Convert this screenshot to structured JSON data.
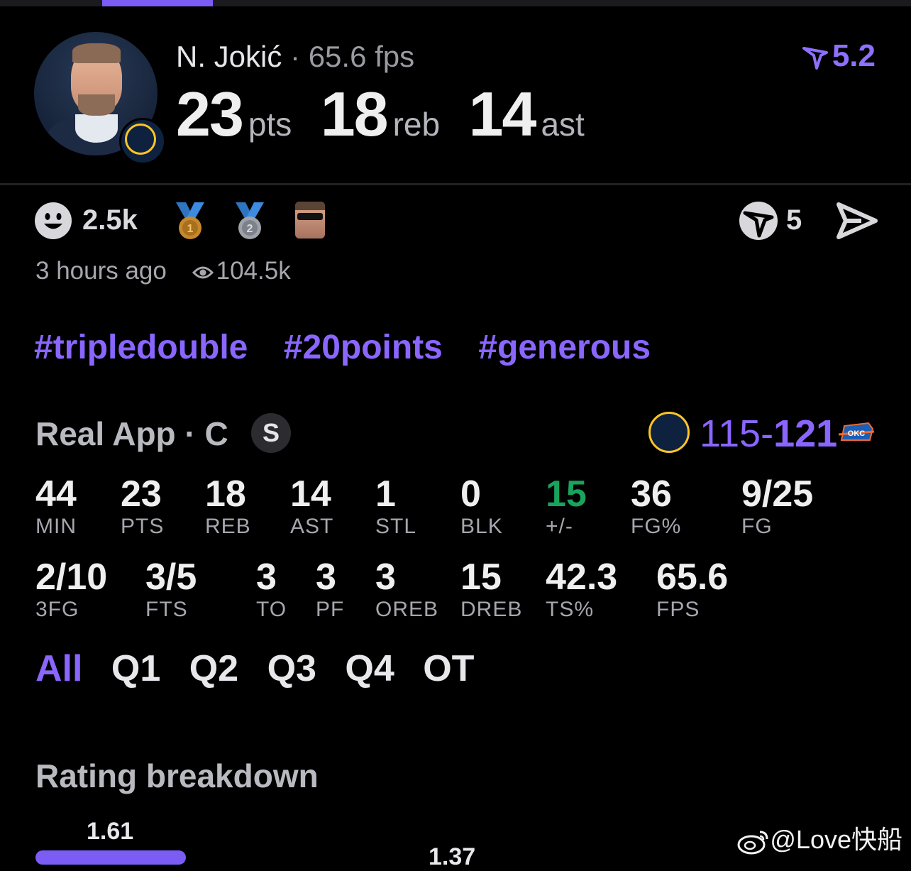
{
  "player": {
    "name": "N. Jokić",
    "separator": "·",
    "fps": "65.6 fps",
    "pts": "23",
    "pts_label": "pts",
    "reb": "18",
    "reb_label": "reb",
    "ast": "14",
    "ast_label": "ast",
    "rating": "5.2"
  },
  "social": {
    "reactions": "2.5k",
    "medal1": "1",
    "medal2": "2",
    "votes": "5",
    "time_ago": "3 hours ago",
    "views": "104.5k"
  },
  "tags": [
    "#tripledouble",
    "#20points",
    "#generous"
  ],
  "game": {
    "title": "Real App · C",
    "badge": "S",
    "score_home": "115",
    "score_dash": "-",
    "score_away": "121",
    "away_logo_text": "OKC"
  },
  "stats_row1": [
    {
      "v": "44",
      "l": "MIN"
    },
    {
      "v": "23",
      "l": "PTS"
    },
    {
      "v": "18",
      "l": "REB"
    },
    {
      "v": "14",
      "l": "AST"
    },
    {
      "v": "1",
      "l": "STL"
    },
    {
      "v": "0",
      "l": "BLK"
    },
    {
      "v": "15",
      "l": "+/-"
    },
    {
      "v": "36",
      "l": "FG%"
    },
    {
      "v": "9/25",
      "l": "FG"
    }
  ],
  "stats_row2": [
    {
      "v": "2/10",
      "l": "3FG"
    },
    {
      "v": "3/5",
      "l": "FTS"
    },
    {
      "v": "3",
      "l": "TO"
    },
    {
      "v": "3",
      "l": "PF"
    },
    {
      "v": "3",
      "l": "OREB"
    },
    {
      "v": "15",
      "l": "DREB"
    },
    {
      "v": "42.3",
      "l": "TS%"
    },
    {
      "v": "65.6",
      "l": "FPS"
    }
  ],
  "periods": [
    "All",
    "Q1",
    "Q2",
    "Q3",
    "Q4",
    "OT"
  ],
  "breakdown": {
    "title": "Rating breakdown",
    "val1": "1.61",
    "val2": "1.37"
  },
  "watermark": "@Love快船",
  "colors": {
    "accent": "#8a66ff",
    "positive": "#19a35c",
    "nuggets_gold": "#fec524"
  }
}
